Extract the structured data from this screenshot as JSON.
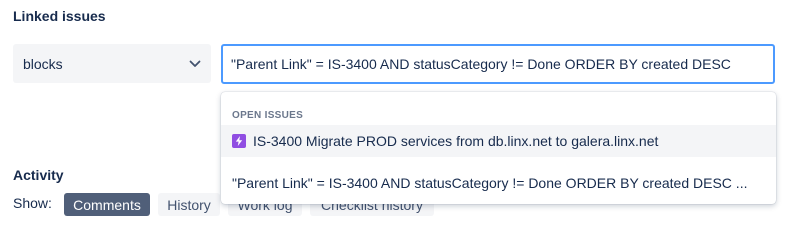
{
  "linked_issues": {
    "title": "Linked issues",
    "link_type": {
      "value": "blocks"
    },
    "search": {
      "value": "\"Parent Link\" = IS-3400 AND statusCategory != Done ORDER BY created DESC"
    }
  },
  "dropdown": {
    "heading": "OPEN ISSUES",
    "items": [
      {
        "label": "IS-3400 Migrate PROD services from db.linx.net to galera.linx.net",
        "icon": "epic-icon",
        "icon_color": "#904ee2"
      },
      {
        "label": "\"Parent Link\" = IS-3400 AND statusCategory != Done ORDER BY created DESC ..."
      }
    ]
  },
  "activity": {
    "title": "Activity",
    "show_label": "Show:",
    "buttons": [
      {
        "label": "Comments",
        "active": true
      },
      {
        "label": "History"
      },
      {
        "label": "Work log"
      },
      {
        "label": "Checklist history"
      }
    ]
  },
  "colors": {
    "accent_focus": "#4c9aff",
    "active_button": "#505f79",
    "epic": "#904ee2"
  }
}
